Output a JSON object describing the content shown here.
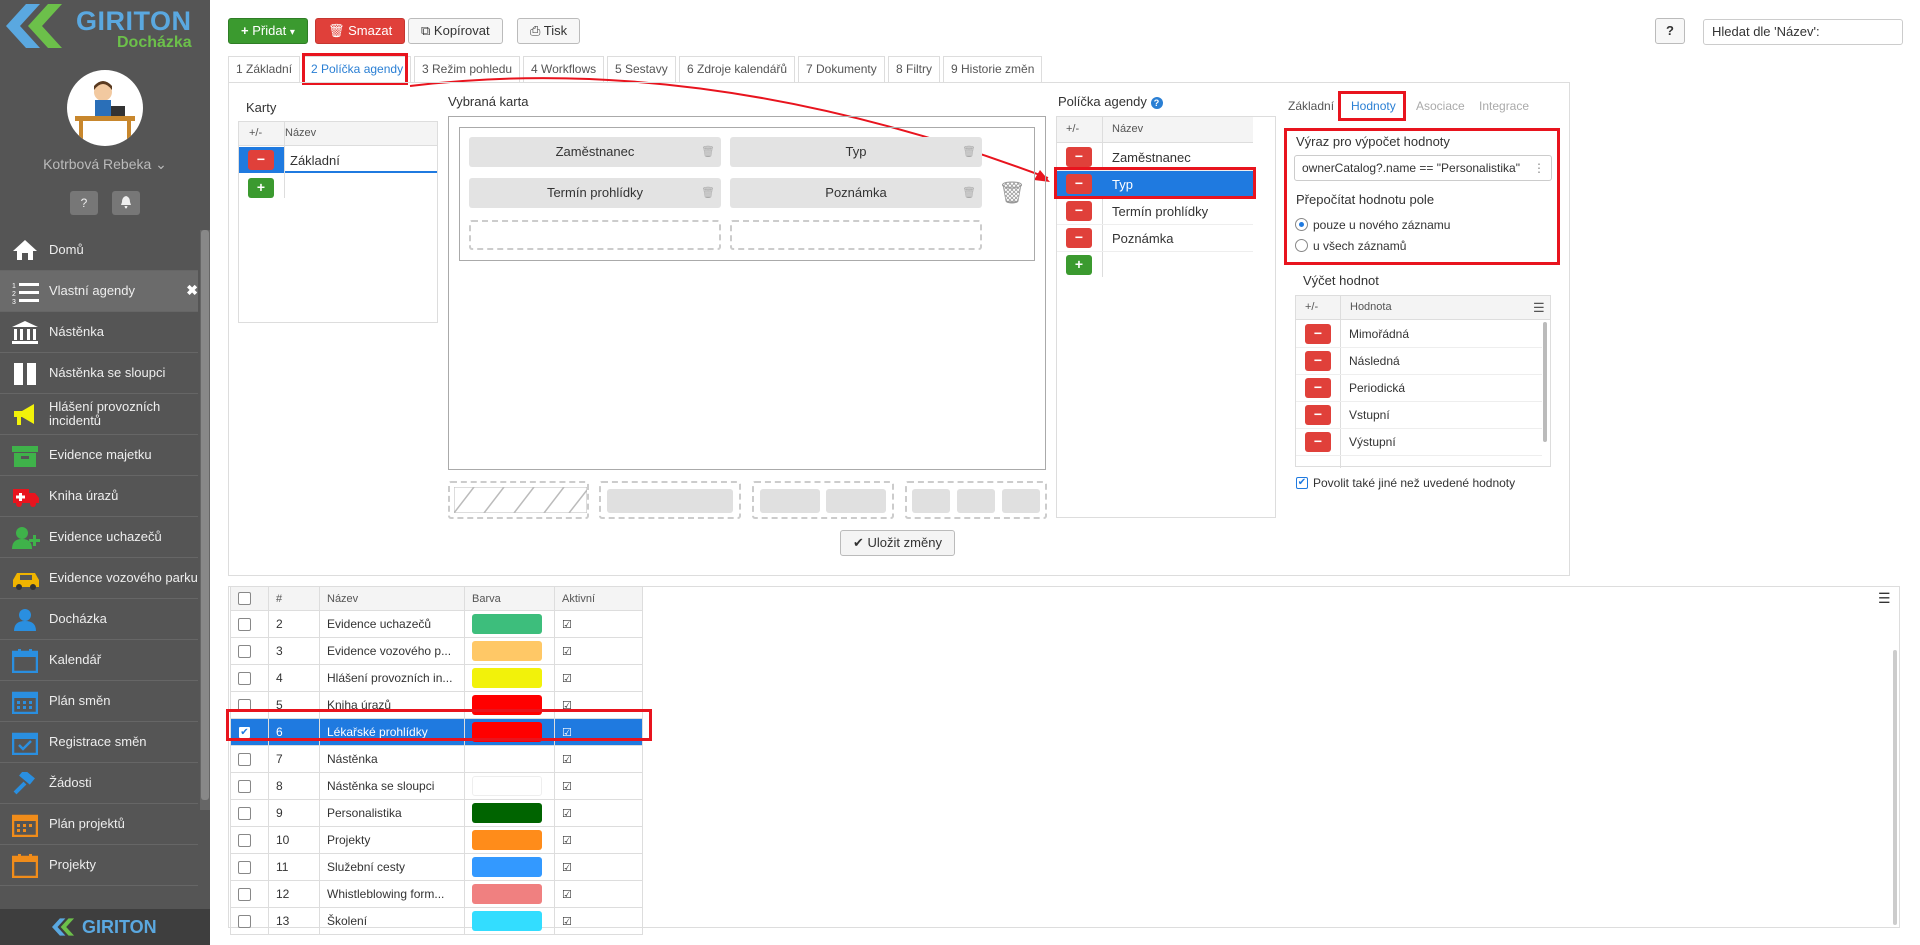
{
  "app": {
    "logo_title": "GIRITON",
    "logo_subtitle": "Docházka",
    "user": "Kotrbová Rebeka",
    "footer_logo": "GIRITON"
  },
  "colors": {
    "accent": "#1f7ae0",
    "primary_green": "#3b9a2f",
    "danger": "#e0403a",
    "highlight": "#e8141e",
    "sidebar": "#555555"
  },
  "sidebar": {
    "help_icon": "question-icon",
    "bell_icon": "bell-icon",
    "items": [
      {
        "label": "Domů",
        "icon": "home-icon"
      },
      {
        "label": "Vlastní agendy",
        "icon": "list-numbered-icon",
        "active": true
      },
      {
        "label": "Nástěnka",
        "icon": "bank-icon"
      },
      {
        "label": "Nástěnka se sloupci",
        "icon": "columns-icon"
      },
      {
        "label": "Hlášení provozních incidentů",
        "icon": "megaphone-icon"
      },
      {
        "label": "Evidence majetku",
        "icon": "box-icon"
      },
      {
        "label": "Kniha úrazů",
        "icon": "ambulance-icon"
      },
      {
        "label": "Evidence uchazečů",
        "icon": "user-add-icon"
      },
      {
        "label": "Evidence vozového parku",
        "icon": "car-icon"
      },
      {
        "label": "Docházka",
        "icon": "user-icon"
      },
      {
        "label": "Kalendář",
        "icon": "calendar-icon"
      },
      {
        "label": "Plán směn",
        "icon": "calendar-grid-icon"
      },
      {
        "label": "Registrace směn",
        "icon": "calendar-check-icon"
      },
      {
        "label": "Žádosti",
        "icon": "gavel-icon"
      },
      {
        "label": "Plán projektů",
        "icon": "calendar-orange-icon"
      },
      {
        "label": "Projekty",
        "icon": "calendar-project-icon"
      }
    ]
  },
  "toolbar": {
    "add": "Přidat",
    "delete": "Smazat",
    "copy": "Kopírovat",
    "print": "Tisk",
    "help": "?",
    "search_placeholder": "Hledat dle 'Název':"
  },
  "tabs": [
    "1 Základní",
    "2 Políčka agendy",
    "3 Režim pohledu",
    "4 Workflows",
    "5 Sestavy",
    "6 Zdroje kalendářů",
    "7 Dokumenty",
    "8 Filtry",
    "9 Historie změn"
  ],
  "cards": {
    "title": "Karty",
    "col_pm": "+/-",
    "col_name": "Název",
    "rows": [
      "Základní"
    ]
  },
  "selected_card": {
    "title": "Vybraná karta",
    "fields": [
      "Zaměstnanec",
      "Typ",
      "Termín prohlídky",
      "Poznámka"
    ]
  },
  "fields": {
    "title": "Políčka agendy",
    "col_pm": "+/-",
    "col_name": "Název",
    "rows": [
      "Zaměstnanec",
      "Typ",
      "Termín prohlídky",
      "Poznámka"
    ],
    "selected": "Typ"
  },
  "props": {
    "tabs": [
      "Základní",
      "Hodnoty",
      "Asociace",
      "Integrace"
    ],
    "expr_label": "Výraz pro výpočet hodnoty",
    "expr_value": "ownerCatalog?.name == \"Personalistika\"",
    "recalc_label": "Přepočítat hodnotu pole",
    "opt1": "pouze u nového záznamu",
    "opt2": "u všech záznamů",
    "enum_label": "Výčet hodnot",
    "col_pm": "+/-",
    "col_value": "Hodnota",
    "values": [
      "Mimořádná",
      "Následná",
      "Periodická",
      "Vstupní",
      "Výstupní"
    ],
    "allow_other": "Povolit také jiné než uvedené hodnoty"
  },
  "save": "Uložit změny",
  "table": {
    "headers": [
      "#",
      "Název",
      "Barva",
      "Aktivní"
    ],
    "rows": [
      {
        "n": "2",
        "name": "Evidence uchazečů",
        "color": "#3dbe7c"
      },
      {
        "n": "3",
        "name": "Evidence vozového p...",
        "color": "#ffc866"
      },
      {
        "n": "4",
        "name": "Hlášení provozních in...",
        "color": "#f2f20a"
      },
      {
        "n": "5",
        "name": "Kniha úrazů",
        "color": "#ff0000"
      },
      {
        "n": "6",
        "name": "Lékařské prohlídky",
        "color": "#ff0000",
        "selected": true
      },
      {
        "n": "7",
        "name": "Nástěnka",
        "color": ""
      },
      {
        "n": "8",
        "name": "Nástěnka se sloupci",
        "color": "#ffffff"
      },
      {
        "n": "9",
        "name": "Personalistika",
        "color": "#006400"
      },
      {
        "n": "10",
        "name": "Projekty",
        "color": "#ff8c1a"
      },
      {
        "n": "11",
        "name": "Služební cesty",
        "color": "#3399ff"
      },
      {
        "n": "12",
        "name": "Whistleblowing form...",
        "color": "#f08080"
      },
      {
        "n": "13",
        "name": "Školení",
        "color": "#33ddff"
      }
    ]
  }
}
